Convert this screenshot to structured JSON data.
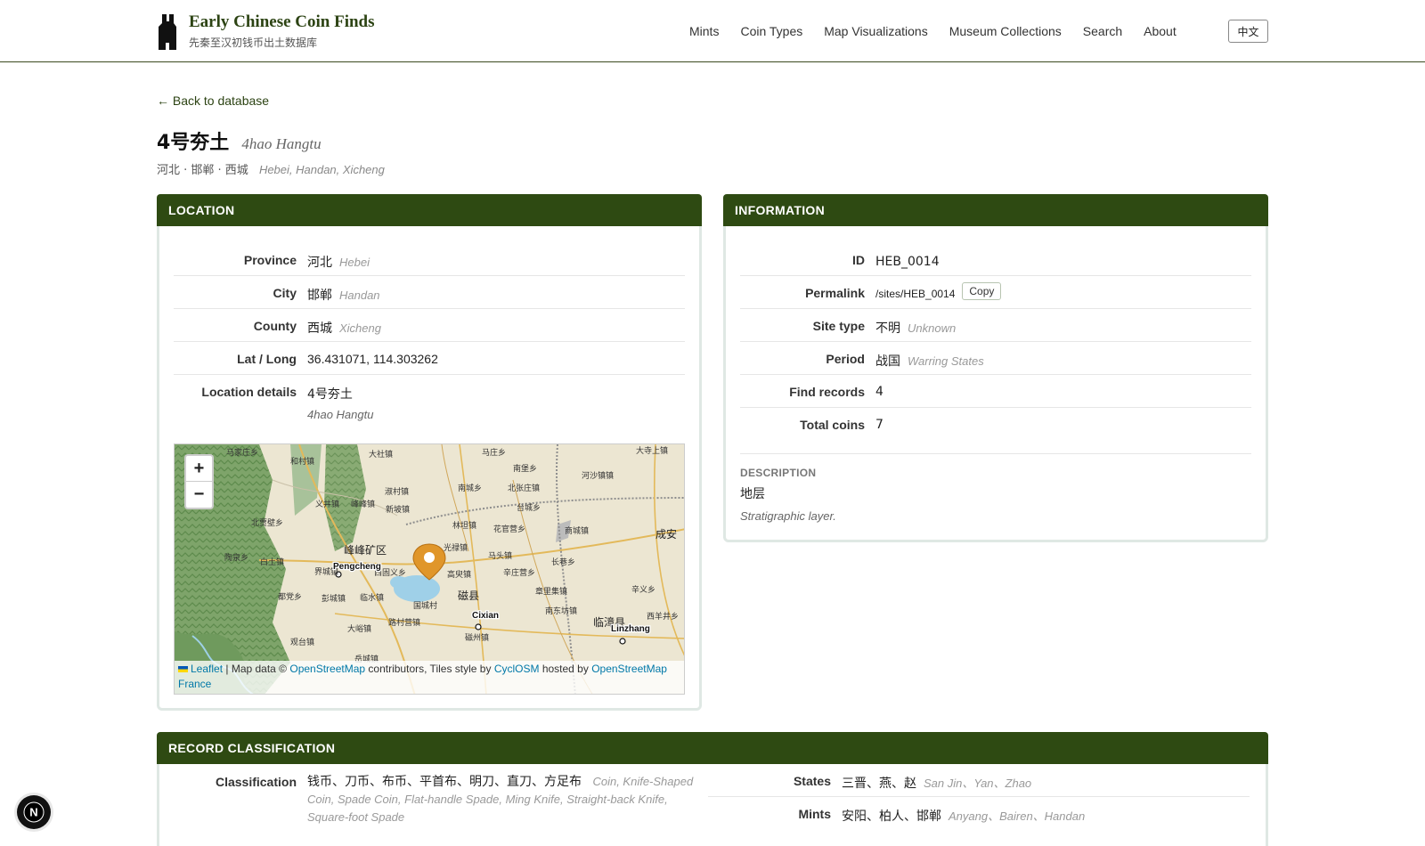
{
  "brand": {
    "title": "Early Chinese Coin Finds",
    "subtitle": "先秦至汉初钱币出土数据库"
  },
  "nav": [
    "Mints",
    "Coin Types",
    "Map Visualizations",
    "Museum Collections",
    "Search",
    "About"
  ],
  "lang_button": "中文",
  "back_link": "← Back to database",
  "site": {
    "title_zh": "4号夯土",
    "title_en": "4hao Hangtu",
    "path_zh": "河北 · 邯郸 · 西城",
    "path_en": "Hebei, Handan, Xicheng"
  },
  "location": {
    "heading": "LOCATION",
    "rows": [
      {
        "label": "Province",
        "zh": "河北",
        "en": "Hebei"
      },
      {
        "label": "City",
        "zh": "邯郸",
        "en": "Handan"
      },
      {
        "label": "County",
        "zh": "西城",
        "en": "Xicheng"
      },
      {
        "label": "Lat / Long",
        "zh": "36.431071, 114.303262",
        "en": ""
      }
    ],
    "details_label": "Location details",
    "details_zh": "4号夯土",
    "details_en": "4hao Hangtu"
  },
  "map": {
    "zoom_in": "+",
    "zoom_out": "−",
    "attribution": {
      "leaflet": "Leaflet",
      "sep1": " | Map data © ",
      "osm": "OpenStreetMap",
      "mid": " contributors, Tiles style by ",
      "cyclosm": "CyclOSM",
      "hosted": " hosted by ",
      "osmfr": "OpenStreetMap France"
    },
    "labels": [
      {
        "text": "马家庄乡"
      },
      {
        "text": "和村镇"
      },
      {
        "text": "大社镇"
      },
      {
        "text": "马庄乡"
      },
      {
        "text": "南堡乡"
      },
      {
        "text": "河沙镇镇"
      },
      {
        "text": "大寺上镇"
      },
      {
        "text": "义井镇"
      },
      {
        "text": "峰峰镇"
      },
      {
        "text": "淑村镇"
      },
      {
        "text": "南城乡"
      },
      {
        "text": "北张庄镇"
      },
      {
        "text": "新坡镇"
      },
      {
        "text": "台城乡"
      },
      {
        "text": "北贾壁乡"
      },
      {
        "text": "林坦镇"
      },
      {
        "text": "花官营乡"
      },
      {
        "text": "商城镇"
      },
      {
        "text": "成安"
      },
      {
        "text": "峰峰矿区"
      },
      {
        "text": "光禄镇"
      },
      {
        "text": "陶泉乡"
      },
      {
        "text": "白土镇"
      },
      {
        "text": "马头镇"
      },
      {
        "text": "长巷乡"
      },
      {
        "text": "界城镇"
      },
      {
        "text": "西固义乡"
      },
      {
        "text": "高臾镇"
      },
      {
        "text": "辛庄营乡"
      },
      {
        "text": "章里集镇"
      },
      {
        "text": "辛义乡"
      },
      {
        "text": "都党乡"
      },
      {
        "text": "彭城镇"
      },
      {
        "text": "临水镇"
      },
      {
        "text": "磁县"
      },
      {
        "text": "国城村"
      },
      {
        "text": "南东坊镇"
      },
      {
        "text": "西羊井乡"
      },
      {
        "text": "路村营镇"
      },
      {
        "text": "大峪镇"
      },
      {
        "text": "磁州镇"
      },
      {
        "text": "临漳县"
      },
      {
        "text": "观台镇"
      },
      {
        "text": "岳城镇"
      },
      {
        "text": "Pengcheng"
      },
      {
        "text": "Cixian"
      },
      {
        "text": "Linzhang"
      }
    ]
  },
  "information": {
    "heading": "INFORMATION",
    "id_label": "ID",
    "id": "HEB_0014",
    "permalink_label": "Permalink",
    "permalink": "/sites/HEB_0014",
    "copy": "Copy",
    "site_type_label": "Site type",
    "site_type_zh": "不明",
    "site_type_en": "Unknown",
    "period_label": "Period",
    "period_zh": "战国",
    "period_en": "Warring States",
    "find_records_label": "Find records",
    "find_records": "4",
    "total_coins_label": "Total coins",
    "total_coins": "7",
    "description_label": "DESCRIPTION",
    "description_zh": "地层",
    "description_en": "Stratigraphic layer."
  },
  "classification": {
    "heading": "RECORD CLASSIFICATION",
    "class_label": "Classification",
    "class_zh": "钱币、刀币、布币、平首布、明刀、直刀、方足布",
    "class_en": "Coin, Knife-Shaped Coin, Spade Coin, Flat-handle Spade, Ming Knife, Straight-back Knife, Square-foot Spade",
    "states_label": "States",
    "states_zh": "三晋、燕、赵",
    "states_en": "San Jin、Yan、Zhao",
    "mints_label": "Mints",
    "mints_zh": "安阳、柏人、邯郸",
    "mints_en": "Anyang、Bairen、Handan"
  },
  "colors": {
    "accent": "#2e4a12",
    "brand": "#2c4313",
    "marker": "#e0962a",
    "link": "#0078a8"
  },
  "fab_label": "N"
}
